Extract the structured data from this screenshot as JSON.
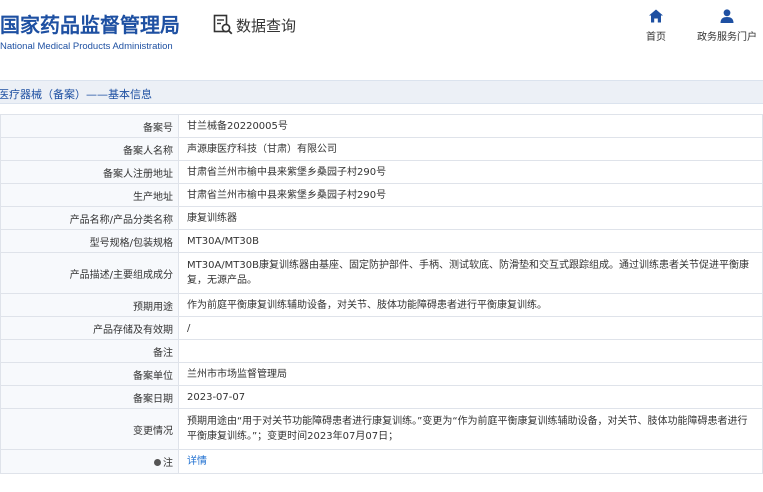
{
  "header": {
    "brand_cn": "国家药品监督管理局",
    "brand_en": "National Medical Products Administration",
    "query_title": "数据查询",
    "nav": [
      {
        "label": "首页",
        "icon": "home-icon"
      },
      {
        "label": "政务服务门户",
        "icon": "user-icon"
      }
    ]
  },
  "section": {
    "title": "医疗器械（备案）——基本信息"
  },
  "record": [
    {
      "label": "备案号",
      "value": "甘兰械备20220005号"
    },
    {
      "label": "备案人名称",
      "value": "声源康医疗科技（甘肃）有限公司"
    },
    {
      "label": "备案人注册地址",
      "value": "甘肃省兰州市榆中县来紫堡乡桑园子村290号"
    },
    {
      "label": "生产地址",
      "value": "甘肃省兰州市榆中县来紫堡乡桑园子村290号"
    },
    {
      "label": "产品名称/产品分类名称",
      "value": "康复训练器"
    },
    {
      "label": "型号规格/包装规格",
      "value": "MT30A/MT30B"
    },
    {
      "label": "产品描述/主要组成成分",
      "value": "MT30A/MT30B康复训练器由基座、固定防护部件、手柄、测试软底、防滑垫和交互式跟踪组成。通过训练患者关节促进平衡康复，无源产品。"
    },
    {
      "label": "预期用途",
      "value": "作为前庭平衡康复训练辅助设备，对关节、肢体功能障碍患者进行平衡康复训练。"
    },
    {
      "label": "产品存储及有效期",
      "value": "/"
    },
    {
      "label": "备注",
      "value": ""
    },
    {
      "label": "备案单位",
      "value": "兰州市市场监督管理局"
    },
    {
      "label": "备案日期",
      "value": "2023-07-07"
    },
    {
      "label": "变更情况",
      "value": "预期用途由“用于对关节功能障碍患者进行康复训练。”变更为“作为前庭平衡康复训练辅助设备，对关节、肢体功能障碍患者进行平衡康复训练。”；变更时间2023年07月07日；"
    }
  ],
  "note_row": {
    "label": "注",
    "link": "详情"
  },
  "colors": {
    "brand_blue": "#1e50a2",
    "link_blue": "#1e6fd0",
    "section_bg": "#ecf0f6",
    "border": "#dfe3ea"
  }
}
